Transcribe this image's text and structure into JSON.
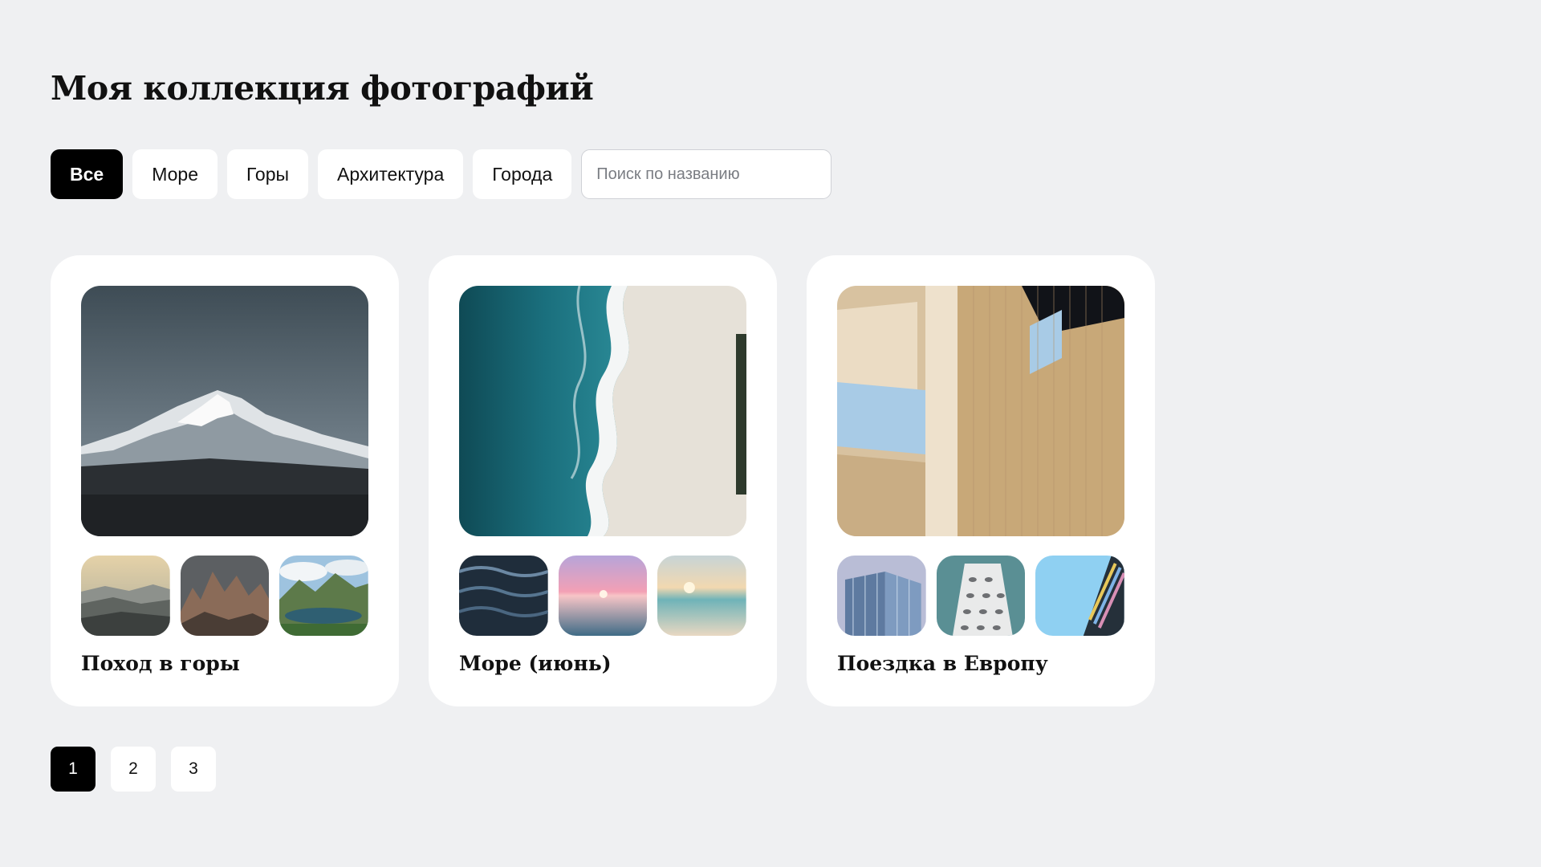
{
  "header": {
    "title": "Моя коллекция фотографий"
  },
  "filters": {
    "chips": [
      {
        "label": "Все",
        "active": true
      },
      {
        "label": "Море",
        "active": false
      },
      {
        "label": "Горы",
        "active": false
      },
      {
        "label": "Архитектура",
        "active": false
      },
      {
        "label": "Города",
        "active": false
      }
    ],
    "search": {
      "placeholder": "Поиск по названию",
      "value": ""
    }
  },
  "albums": [
    {
      "title": "Поход в горы"
    },
    {
      "title": "Море (июнь)"
    },
    {
      "title": "Поездка в Европу"
    }
  ],
  "pagination": {
    "pages": [
      "1",
      "2",
      "3"
    ],
    "current": "1"
  },
  "colors": {
    "background": "#eff0f2",
    "card": "#ffffff",
    "active": "#000000"
  }
}
